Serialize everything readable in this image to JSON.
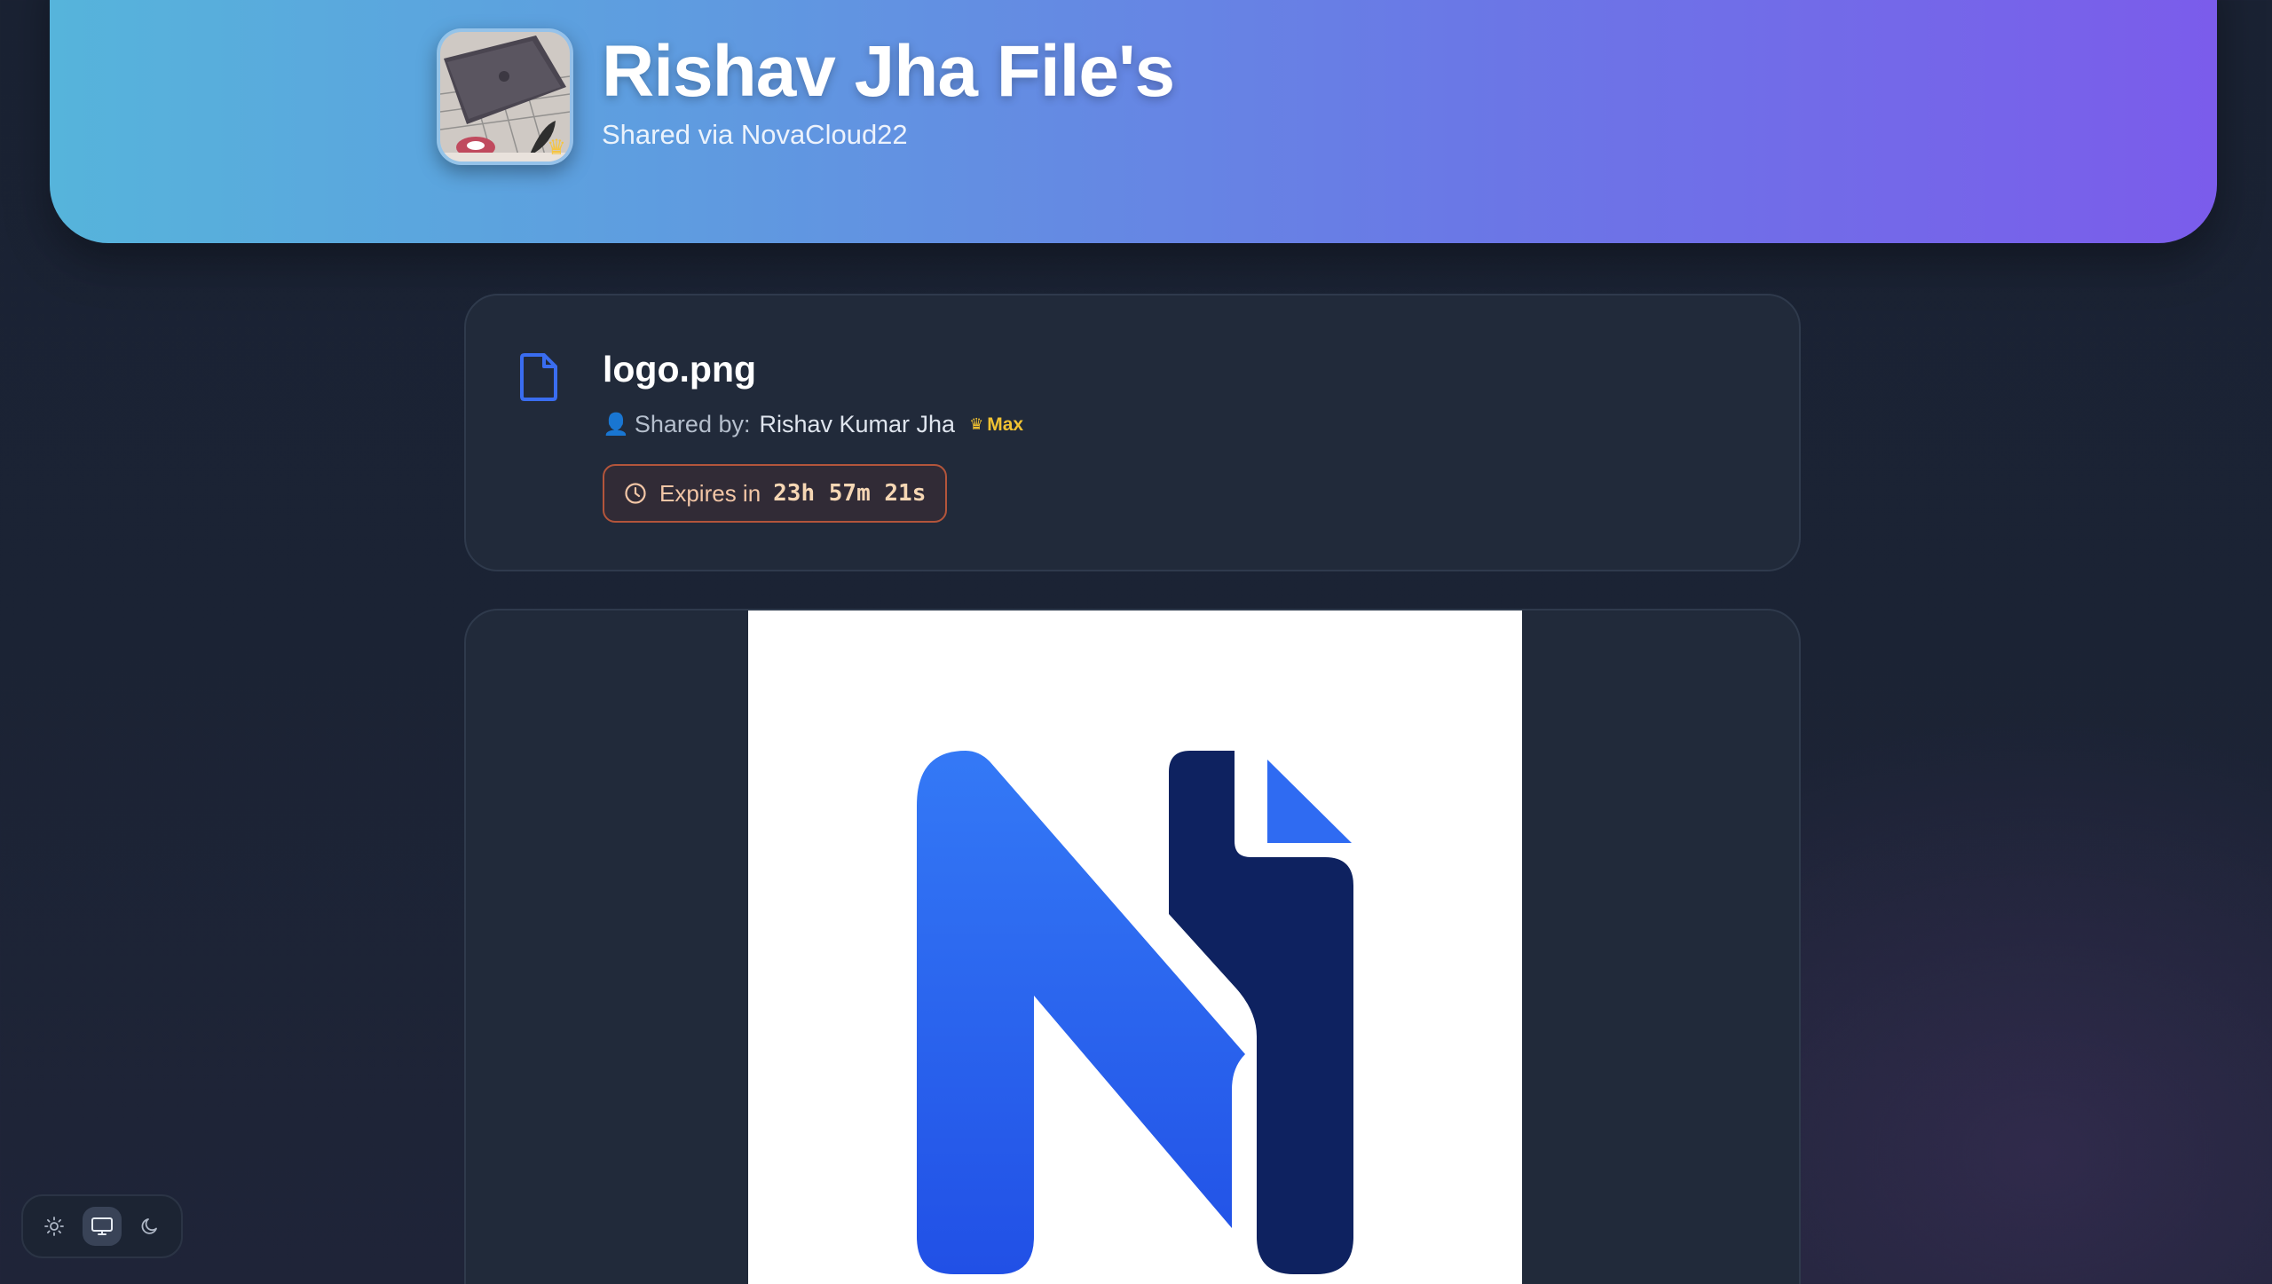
{
  "header": {
    "title": "Rishav Jha File's",
    "subtitle": "Shared via NovaCloud22",
    "avatar_icon": "user-photo-avatar",
    "avatar_badge_icon": "crown-icon"
  },
  "file": {
    "name": "logo.png",
    "icon": "file-icon",
    "shared_by_label": "Shared by:",
    "owner_name": "Rishav Kumar Jha",
    "plan_label": "Max",
    "expires_label": "Expires in",
    "expires_value": "23h 57m 21s"
  },
  "preview": {
    "alt": "logo.png preview",
    "logo_icon": "novacloud-n-logo"
  },
  "theme_switcher": {
    "options": [
      {
        "name": "light",
        "icon": "sun-icon"
      },
      {
        "name": "system",
        "icon": "monitor-icon"
      },
      {
        "name": "dark",
        "icon": "moon-icon"
      }
    ],
    "selected": "system"
  },
  "colors": {
    "hero_start": "#56b4db",
    "hero_end": "#7b5ceb",
    "card_bg": "#212a3a",
    "accent_blue": "#3a6df0",
    "expire_border": "#b3553b",
    "plan_gold": "#f1c232"
  }
}
